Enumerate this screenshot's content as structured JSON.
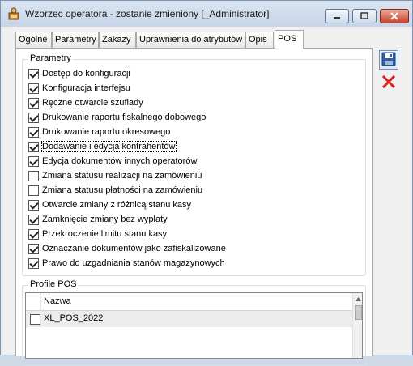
{
  "window": {
    "title": "Wzorzec operatora - zostanie zmieniony [_Administrator]"
  },
  "tabs": [
    {
      "label": "Ogólne",
      "active": false
    },
    {
      "label": "Parametry",
      "active": false
    },
    {
      "label": "Zakazy",
      "active": false
    },
    {
      "label": "Uprawnienia do atrybutów",
      "active": false
    },
    {
      "label": "Opis",
      "active": false
    },
    {
      "label": "POS",
      "active": true
    }
  ],
  "parametry": {
    "title": "Parametry",
    "items": [
      {
        "label": "Dostęp do konfiguracji",
        "checked": true
      },
      {
        "label": "Konfiguracja interfejsu",
        "checked": true
      },
      {
        "label": "Ręczne otwarcie szuflady",
        "checked": true
      },
      {
        "label": "Drukowanie raportu fiskalnego dobowego",
        "checked": true
      },
      {
        "label": "Drukowanie raportu okresowego",
        "checked": true
      },
      {
        "label": "Dodawanie i edycja kontrahentów",
        "checked": true,
        "focused": true
      },
      {
        "label": "Edycja dokumentów innych operatorów",
        "checked": true
      },
      {
        "label": "Zmiana statusu realizacji na zamówieniu",
        "checked": false
      },
      {
        "label": "Zmiana statusu płatności na zamówieniu",
        "checked": false
      },
      {
        "label": "Otwarcie zmiany z różnicą stanu kasy",
        "checked": true
      },
      {
        "label": "Zamknięcie zmiany bez wypłaty",
        "checked": true
      },
      {
        "label": "Przekroczenie limitu stanu kasy",
        "checked": true
      },
      {
        "label": "Oznaczanie dokumentów jako zafiskalizowane",
        "checked": true
      },
      {
        "label": "Prawo do uzgadniania stanów magazynowych",
        "checked": true
      }
    ]
  },
  "profile_pos": {
    "title": "Profile POS",
    "column_header": "Nazwa",
    "rows": [
      {
        "name": "XL_POS_2022",
        "checked": false
      }
    ]
  },
  "icons": {
    "app": "app-person-icon",
    "save": "save-disk-icon",
    "cancel": "cancel-x-icon",
    "accent_save": "#2f5fa8",
    "accent_cancel": "#d9251c"
  }
}
